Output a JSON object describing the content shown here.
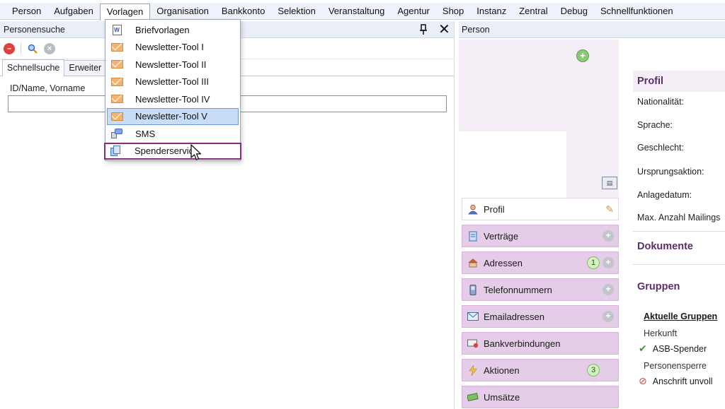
{
  "menubar": {
    "items": [
      "Person",
      "Aufgaben",
      "Vorlagen",
      "Organisation",
      "Bankkonto",
      "Selektion",
      "Veranstaltung",
      "Agentur",
      "Shop",
      "Instanz",
      "Zentral",
      "Debug",
      "Schnellfunktionen"
    ],
    "open_index": 2
  },
  "left_pane": {
    "title": "Personensuche",
    "pin_icon": "pin-icon",
    "close_label": "✕",
    "tabs": [
      "Schnellsuche",
      "Erweiter"
    ],
    "field_label": "ID/Name, Vorname",
    "field_value": ""
  },
  "dropdown": {
    "items": [
      {
        "label": "Briefvorlagen",
        "icon": "word-document-icon"
      },
      {
        "label": "Newsletter-Tool I",
        "icon": "envelope-icon"
      },
      {
        "label": "Newsletter-Tool II",
        "icon": "envelope-icon"
      },
      {
        "label": "Newsletter-Tool III",
        "icon": "envelope-icon"
      },
      {
        "label": "Newsletter-Tool IV",
        "icon": "envelope-icon"
      },
      {
        "label": "Newsletter-Tool V",
        "icon": "envelope-icon"
      },
      {
        "label": "SMS",
        "icon": "sms-icon"
      },
      {
        "label": "Spenderservic",
        "icon": "documents-icon"
      }
    ],
    "hover_index": 5,
    "outlined_index": 7
  },
  "right_pane": {
    "title": "Person",
    "nav": [
      {
        "label": "Profil",
        "icon": "person-icon",
        "active": true
      },
      {
        "label": "Verträge",
        "icon": "contract-icon"
      },
      {
        "label": "Adressen",
        "icon": "house-icon",
        "badge": "1"
      },
      {
        "label": "Telefonnummern",
        "icon": "phone-icon"
      },
      {
        "label": "Emailadressen",
        "icon": "email-icon"
      },
      {
        "label": "Bankverbindungen",
        "icon": "bank-icon"
      },
      {
        "label": "Aktionen",
        "icon": "lightning-icon",
        "badge": "3"
      },
      {
        "label": "Umsätze",
        "icon": "money-icon"
      }
    ],
    "sections": {
      "profil": "Profil",
      "dokumente": "Dokumente",
      "gruppen": "Gruppen"
    },
    "profil_labels": [
      "Nationalität:",
      "Sprache:",
      "Geschlecht:",
      "Ursprungsaktion:",
      "Anlagedatum:",
      "Max. Anzahl Mailings"
    ],
    "gruppen": {
      "current_title": "Aktuelle Gruppen",
      "herkunft_label": "Herkunft",
      "herkunft_value": "ASB-Spender",
      "sperre_label": "Personensperre",
      "sperre_value": "Anschrift unvoll"
    }
  },
  "colors": {
    "menubar_bg": "#eef2fa",
    "nav_bg": "#e5cce9",
    "section_title": "#5a2e6b",
    "highlight_outline": "#8a2a78",
    "hover_bg": "#c7dcf5"
  }
}
